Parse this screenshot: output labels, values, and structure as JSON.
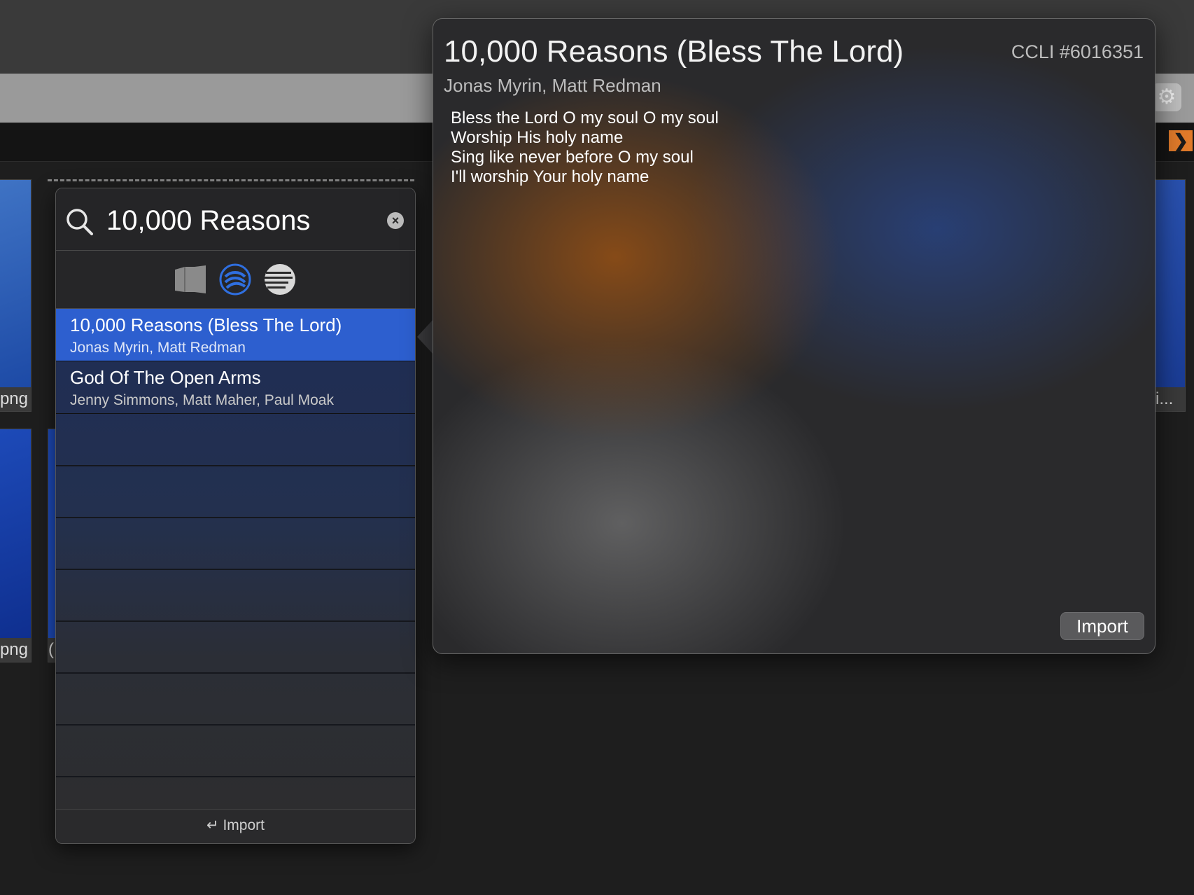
{
  "background": {
    "thumb_captions": [
      "png",
      "png",
      "i...",
      "("
    ],
    "accent_color": "#e07a2a"
  },
  "search": {
    "value": "10,000 Reasons",
    "sources": [
      "library-icon",
      "songselect-icon",
      "lyrics-icon"
    ],
    "results": [
      {
        "title": "10,000 Reasons (Bless The Lord)",
        "authors": "Jonas Myrin, Matt Redman",
        "selected": true
      },
      {
        "title": "God Of The Open Arms",
        "authors": "Jenny Simmons, Matt Maher, Paul Moak",
        "selected": false
      }
    ],
    "footer_import": "Import",
    "selection_color": "#2d5fcf"
  },
  "preview": {
    "title": "10,000 Reasons (Bless The Lord)",
    "ccli": "CCLI #6016351",
    "authors": "Jonas Myrin, Matt Redman",
    "lyrics": [
      "Bless the Lord O my soul O my soul",
      "Worship His holy name",
      "Sing like never before O my soul",
      "I'll worship Your holy name"
    ],
    "import_label": "Import"
  }
}
